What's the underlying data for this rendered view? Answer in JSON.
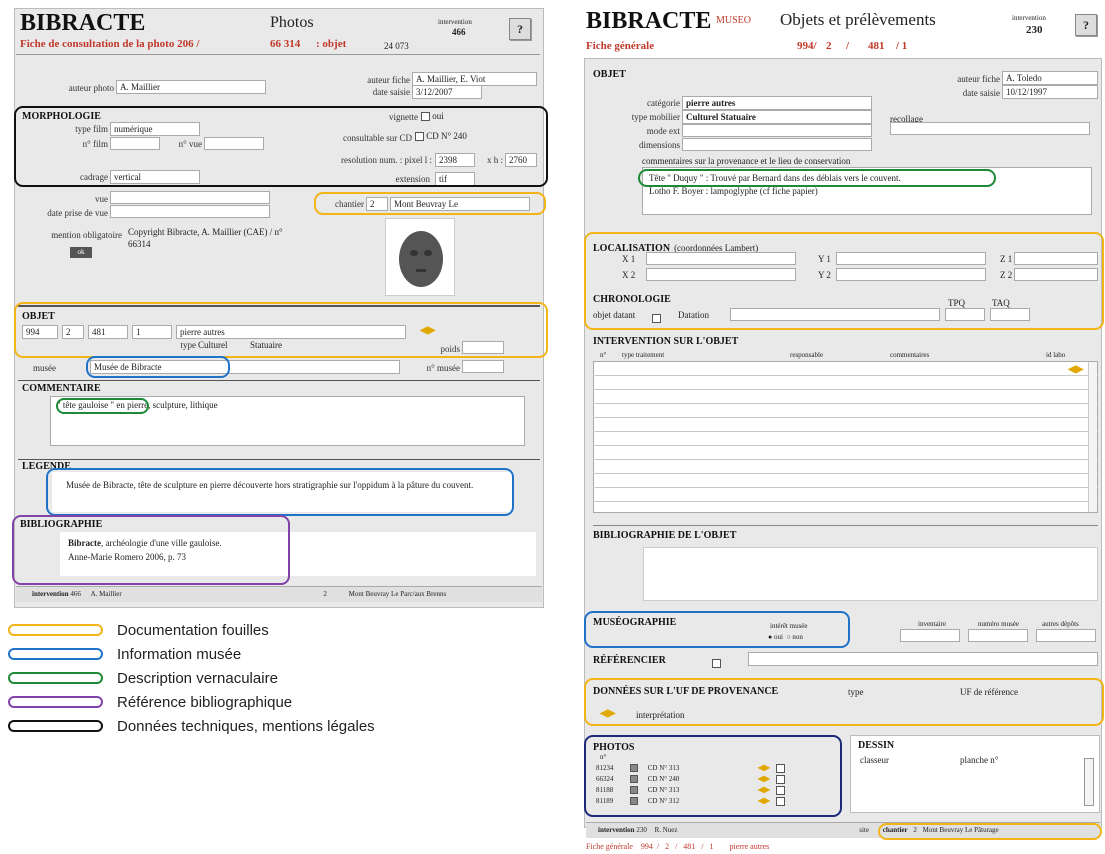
{
  "left": {
    "title": "BIBRACTE",
    "section": "Photos",
    "subtitle": "Fiche de consultation de la photo 206 /",
    "ref": "66 314",
    "objet": ": objet",
    "num": "24 073",
    "intervention_label": "intervention",
    "intervention_val": "466",
    "help": "?",
    "auteur_photo_label": "auteur photo",
    "auteur_photo": "A. Maillier",
    "auteur_fiche_label": "auteur fiche",
    "auteur_fiche": "A. Maillier, E. Viot",
    "date_saisie_label": "date saisie",
    "date_saisie": "3/12/2007",
    "morph_title": "MORPHOLOGIE",
    "type_label": "type film",
    "type_val": "numérique",
    "nfilm_label": "n° film",
    "nvue_label": "n° vue",
    "vignette_label": "vignette",
    "vignette_val": "oui",
    "consult_label": "consultable sur CD",
    "consult_val": "CD N° 240",
    "resol_label": "resolution num. : pixel l :",
    "resol_l": "2398",
    "resol_h_label": "x h :",
    "resol_h": "2760",
    "cadrage_label": "cadrage",
    "cadrage_val": "vertical",
    "extension_label": "extension",
    "extension_val": "tif",
    "vue_label": "vue",
    "date_prise_label": "date prise de vue",
    "chantier_label": "chantier",
    "chantier_num": "2",
    "chantier_val": "Mont Beuvray Le",
    "mention_label": "mention obligatoire",
    "mention_val": "Copyright Bibracte, A. Maillier (CAE) / n° 66314",
    "ok": "ok",
    "objet_title": "OBJET",
    "obj_c1": "994",
    "obj_c2": "2",
    "obj_c3": "481",
    "obj_c4": "1",
    "obj_type": "pierre autres",
    "obj_type_label": "type",
    "obj_type2": "Culturel",
    "obj_type3": "Statuaire",
    "poids_label": "poids",
    "musee_label": "musée",
    "musee_val": "Musée de Bibracte",
    "nmusee_label": "n° musée",
    "comment_title": "COMMENTAIRE",
    "comment_green": "\" tête gauloise \"",
    "comment_rest": "en pierre, sculpture, lithique",
    "legende_title": "LEGENDE",
    "legende_val": "Musée de Bibracte, tête de sculpture en pierre découverte hors stratigraphie sur l'oppidum à la pâture du couvent.",
    "biblio_title": "BIBLIOGRAPHIE",
    "biblio_bold": "Bibracte",
    "biblio_rest": ", archéologie d'une ville gauloise.",
    "biblio_line2": "Anne-Marie Romero 2006, p. 73",
    "footer_l1": "intervention",
    "footer_l2": "466",
    "footer_l3": "A. Maillier",
    "footer_r1": "2",
    "footer_r2": "Mont Beuvray Le Parc/aux Brenns"
  },
  "legend": [
    {
      "label": "Documentation fouilles",
      "color": "#f2b418"
    },
    {
      "label": "Information musée",
      "color": "#1f73c9"
    },
    {
      "label": "Description vernaculaire",
      "color": "#1d8a36"
    },
    {
      "label": "Référence bibliographique",
      "color": "#8243a8"
    },
    {
      "label": "Données techniques, mentions légales",
      "color": "#111111"
    }
  ],
  "right": {
    "title": "BIBRACTE",
    "museo": "MUSEO",
    "section": "Objets et prélèvements",
    "intervention_label": "intervention",
    "intervention_val": "230",
    "help": "?",
    "subtitle": "Fiche générale",
    "c1": "994/",
    "c2": "2",
    "c3": "/",
    "c4": "481",
    "c5": "/ 1",
    "objet_title": "OBJET",
    "auteur_fiche_label": "auteur fiche",
    "auteur_fiche": "A. Toledo",
    "date_label": "date saisie",
    "date_val": "10/12/1997",
    "cat_label": "catégorie",
    "cat_val": "pierre autres",
    "type_label": "type mobilier",
    "type_val": "Culturel   Statuaire",
    "recoll_label": "recollage",
    "mod_label": "mode ext",
    "dim_label": "dimensions",
    "comm_label": "commentaires sur la provenance et le lieu de conservation",
    "comm_green": "Tête \" Duquy \" : Trouvé par Bernard dans des déblais vers le couvent.",
    "comm_line2": "Lotho F. Boyer : lampoglyphe (cf fiche papier)",
    "loc_title": "LOCALISATION",
    "loc_sub": "(coordonnées Lambert)",
    "x1": "X 1",
    "y1": "Y 1",
    "z1": "Z 1",
    "x2": "X 2",
    "y2": "Y 2",
    "z2": "Z 2",
    "chrono_title": "CHRONOLOGIE",
    "objet_datant": "objet datant",
    "datation": "Datation",
    "tpq": "TPQ",
    "taq": "TAQ",
    "interv_title": "INTERVENTION SUR L'OBJET",
    "h1": "n°",
    "h2": "type traitement",
    "h3": "responsable",
    "h4": "commentaires",
    "h5": "id labo",
    "biblio_title": "BIBLIOGRAPHIE DE L'OBJET",
    "museo_title": "MUSÉOGRAPHIE",
    "museo_sub": "intérêt musée",
    "oui": "oui",
    "non": "non",
    "museo_f1": "inventaire",
    "museo_f2": "numéro musée",
    "museo_f3": "autres dépôts",
    "ref_title": "RÉFÉRENCIER",
    "uf_title": "DONNÉES SUR L'UF DE PROVENANCE",
    "uf_type": "type",
    "uf_ref": "UF de référence",
    "uf_interp": "interprétation",
    "photos_title": "PHOTOS",
    "photos_n": "n°",
    "photos": [
      {
        "num": "81234",
        "cd": "CD N° 313"
      },
      {
        "num": "66324",
        "cd": "CD N° 240"
      },
      {
        "num": "81188",
        "cd": "CD N° 313"
      },
      {
        "num": "81189",
        "cd": "CD N° 312"
      }
    ],
    "dessin_title": "DESSIN",
    "classeur": "classeur",
    "planche": "planche n°",
    "footer_l1": "intervention",
    "footer_l2": "230",
    "footer_l3": "R. Nuez",
    "footer_r0": "site",
    "footer_r1": "chantier",
    "footer_r2": "2",
    "footer_r3": "Mont Beuvray Le Pâturage",
    "bottom": "Fiche générale    994  /   2   /   481   /   1        pierre autres"
  }
}
